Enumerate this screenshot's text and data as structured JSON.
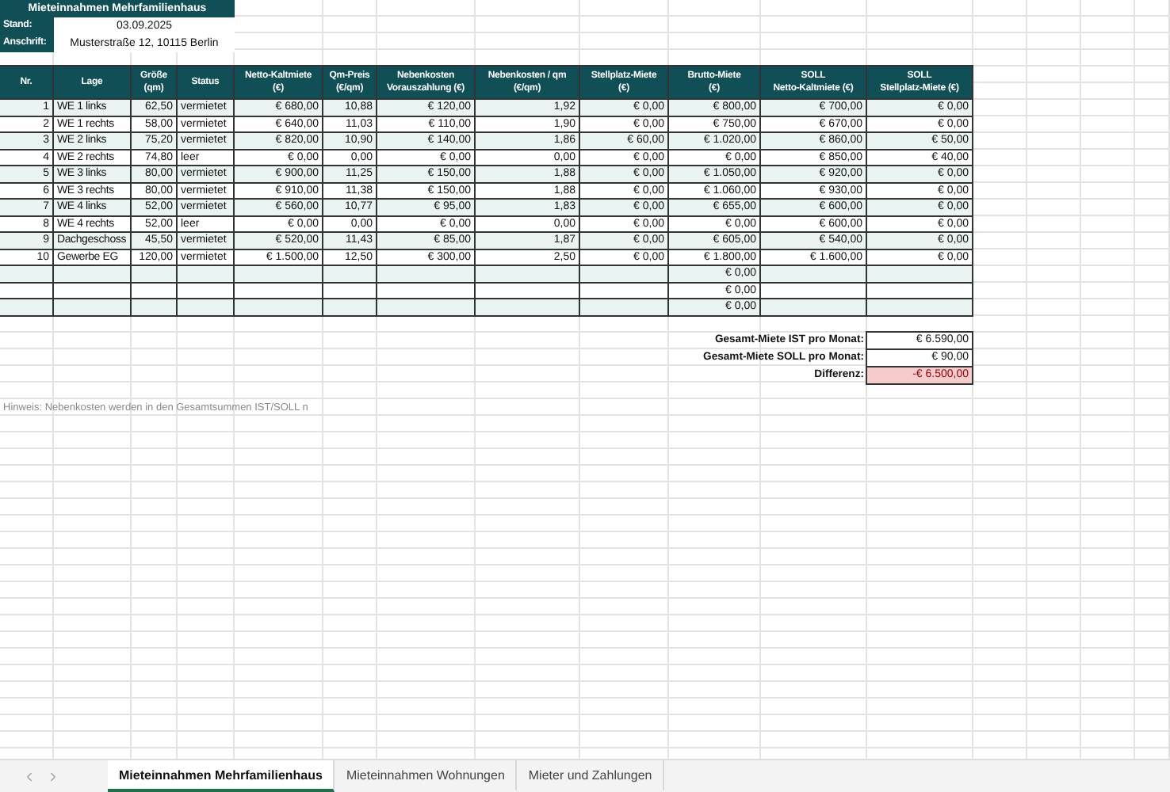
{
  "sheet": {
    "title": "Mieteinnahmen Mehrfamilienhaus",
    "info": [
      {
        "label": "Stand:",
        "value": "03.09.2025"
      },
      {
        "label": "Anschrift:",
        "value": "Musterstraße 12, 10115 Berlin"
      }
    ]
  },
  "table": {
    "columns": [
      "Nr.",
      "Lage",
      "Größe\n(qm)",
      "Status",
      "Netto-Kaltmiete\n(€)",
      "Qm-Preis\n(€/qm)",
      "Nebenkosten\nVorauszahlung (€)",
      "Nebenkosten / qm\n(€/qm)",
      "Stellplatz-Miete\n(€)",
      "Brutto-Miete\n(€)",
      "SOLL\nNetto-Kaltmiete (€)",
      "SOLL\nStellplatz-Miete (€)"
    ],
    "rows": [
      {
        "kind": "entry",
        "cells": [
          "1",
          "WE 1 links",
          "62,50",
          "vermietet",
          "€ 680,00",
          "10,88",
          "€ 120,00",
          "1,92",
          "€ 0,00",
          "€ 800,00",
          "€ 700,00",
          "€ 0,00"
        ]
      },
      {
        "kind": "entry",
        "cells": [
          "2",
          "WE 1 rechts",
          "58,00",
          "vermietet",
          "€ 640,00",
          "11,03",
          "€ 110,00",
          "1,90",
          "€ 0,00",
          "€ 750,00",
          "€ 670,00",
          "€ 0,00"
        ]
      },
      {
        "kind": "entry",
        "cells": [
          "3",
          "WE 2 links",
          "75,20",
          "vermietet",
          "€ 820,00",
          "10,90",
          "€ 140,00",
          "1,86",
          "€ 60,00",
          "€ 1.020,00",
          "€ 860,00",
          "€ 50,00"
        ]
      },
      {
        "kind": "entry",
        "cells": [
          "4",
          "WE 2 rechts",
          "74,80",
          "leer",
          "€ 0,00",
          "0,00",
          "€ 0,00",
          "0,00",
          "€ 0,00",
          "€ 0,00",
          "€ 850,00",
          "€ 40,00"
        ]
      },
      {
        "kind": "entry",
        "cells": [
          "5",
          "WE 3 links",
          "80,00",
          "vermietet",
          "€ 900,00",
          "11,25",
          "€ 150,00",
          "1,88",
          "€ 0,00",
          "€ 1.050,00",
          "€ 920,00",
          "€ 0,00"
        ]
      },
      {
        "kind": "entry",
        "cells": [
          "6",
          "WE 3 rechts",
          "80,00",
          "vermietet",
          "€ 910,00",
          "11,38",
          "€ 150,00",
          "1,88",
          "€ 0,00",
          "€ 1.060,00",
          "€ 930,00",
          "€ 0,00"
        ]
      },
      {
        "kind": "entry",
        "cells": [
          "7",
          "WE 4 links",
          "52,00",
          "vermietet",
          "€ 560,00",
          "10,77",
          "€ 95,00",
          "1,83",
          "€ 0,00",
          "€ 655,00",
          "€ 600,00",
          "€ 0,00"
        ]
      },
      {
        "kind": "entry",
        "cells": [
          "8",
          "WE 4 rechts",
          "52,00",
          "leer",
          "€ 0,00",
          "0,00",
          "€ 0,00",
          "0,00",
          "€ 0,00",
          "€ 0,00",
          "€ 600,00",
          "€ 0,00"
        ]
      },
      {
        "kind": "entry",
        "cells": [
          "9",
          "Dachgeschoss",
          "45,50",
          "vermietet",
          "€ 520,00",
          "11,43",
          "€ 85,00",
          "1,87",
          "€ 0,00",
          "€ 605,00",
          "€ 540,00",
          "€ 0,00"
        ]
      },
      {
        "kind": "entry",
        "cells": [
          "10",
          "Gewerbe EG",
          "120,00",
          "vermietet",
          "€ 1.500,00",
          "12,50",
          "€ 300,00",
          "2,50",
          "€ 0,00",
          "€ 1.800,00",
          "€ 1.600,00",
          "€ 0,00"
        ]
      },
      {
        "kind": "empty",
        "brutto": "€ 0,00"
      },
      {
        "kind": "empty",
        "brutto": "€ 0,00"
      },
      {
        "kind": "empty",
        "brutto": "€ 0,00"
      }
    ]
  },
  "totals": [
    {
      "label": "Gesamt-Miete IST pro Monat:",
      "value": "€ 6.590,00",
      "kind": "normal"
    },
    {
      "label": "Gesamt-Miete SOLL pro Monat:",
      "value": "€ 90,00",
      "kind": "normal"
    },
    {
      "label": "Differenz:",
      "value": "-€ 6.500,00",
      "kind": "negative"
    }
  ],
  "note": "Hinweis: Nebenkosten werden in den Gesamtsummen IST/SOLL n",
  "sheet_tabs": [
    {
      "label": "Mieteinnahmen Mehrfamilienhaus",
      "selected": true
    },
    {
      "label": "Mieteinnahmen Wohnungen",
      "selected": false
    },
    {
      "label": "Mieter und Zahlungen",
      "selected": false
    }
  ]
}
